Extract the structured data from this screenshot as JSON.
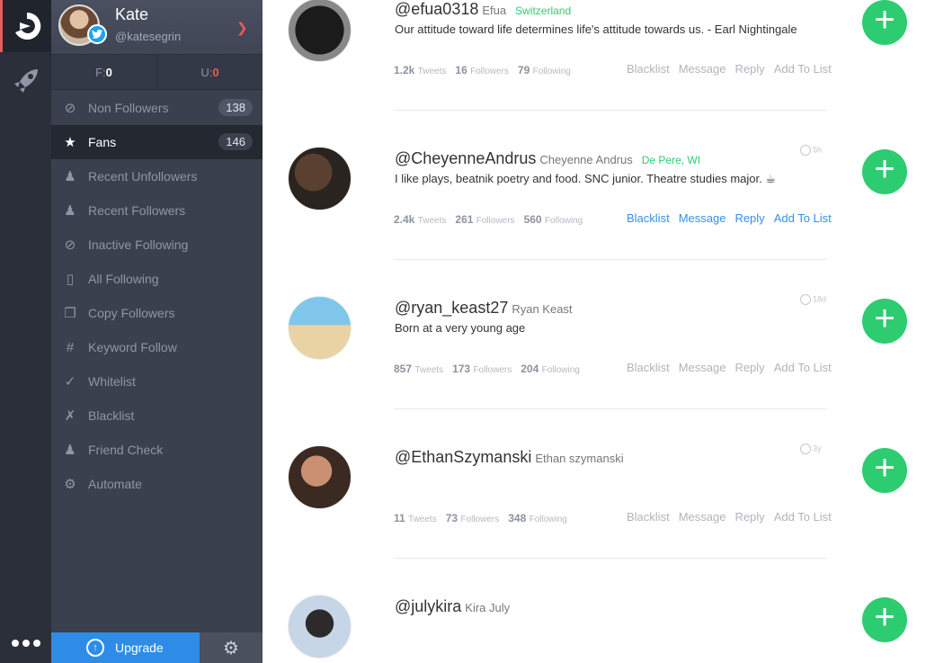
{
  "profile": {
    "name": "Kate",
    "handle": "@katesegrin"
  },
  "stats": {
    "f_label": "F:",
    "f_value": "0",
    "u_label": "U:",
    "u_value": "0"
  },
  "menu": [
    {
      "label": "Non Followers",
      "count": "138",
      "icon": "block-icon"
    },
    {
      "label": "Fans",
      "count": "146",
      "icon": "star-icon"
    },
    {
      "label": "Recent Unfollowers",
      "icon": "user-minus-icon"
    },
    {
      "label": "Recent Followers",
      "icon": "user-plus-icon"
    },
    {
      "label": "Inactive Following",
      "icon": "block-icon"
    },
    {
      "label": "All Following",
      "icon": "file-icon"
    },
    {
      "label": "Copy Followers",
      "icon": "copy-icon"
    },
    {
      "label": "Keyword Follow",
      "icon": "hash-icon"
    },
    {
      "label": "Whitelist",
      "icon": "check-file-icon"
    },
    {
      "label": "Blacklist",
      "icon": "x-file-icon"
    },
    {
      "label": "Friend Check",
      "icon": "friends-icon"
    },
    {
      "label": "Automate",
      "icon": "gears-icon"
    }
  ],
  "upgrade_label": "Upgrade",
  "users": [
    {
      "handle": "@efua0318",
      "name": "Efua",
      "location": "Switzerland",
      "bio": "Our attitude toward life determines life's attitude towards us. - Earl Nightingale",
      "tweets": "1.2k",
      "followers": "16",
      "following": "79",
      "time": ""
    },
    {
      "handle": "@CheyenneAndrus",
      "name": "Cheyenne Andrus",
      "location": "De Pere, WI",
      "bio": "I like plays, beatnik poetry and food. SNC junior. Theatre studies major. ☕",
      "tweets": "2.4k",
      "followers": "261",
      "following": "560",
      "time": "5h"
    },
    {
      "handle": "@ryan_keast27",
      "name": "Ryan Keast",
      "location": "",
      "bio": "Born at a very young age",
      "tweets": "857",
      "followers": "173",
      "following": "204",
      "time": "18d"
    },
    {
      "handle": "@EthanSzymanski",
      "name": "Ethan szymanski",
      "location": "",
      "bio": "",
      "tweets": "11",
      "followers": "73",
      "following": "348",
      "time": "3y"
    },
    {
      "handle": "@julykira",
      "name": "Kira July",
      "location": "",
      "bio": "",
      "tweets": "",
      "followers": "",
      "following": "",
      "time": ""
    }
  ],
  "labels": {
    "tweets": "Tweets",
    "followers": "Followers",
    "following": "Following",
    "blacklist": "Blacklist",
    "message": "Message",
    "reply": "Reply",
    "add_to_list": "Add To List"
  }
}
